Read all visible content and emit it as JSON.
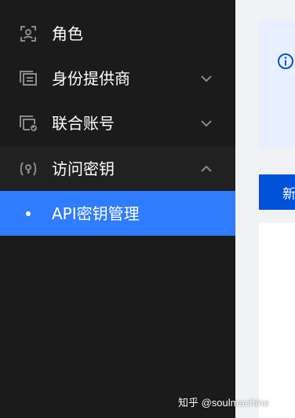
{
  "sidebar": {
    "items": [
      {
        "label": "角色",
        "icon": "role-icon",
        "expandable": false
      },
      {
        "label": "身份提供商",
        "icon": "identity-provider-icon",
        "expandable": true,
        "expanded": false
      },
      {
        "label": "联合账号",
        "icon": "federated-account-icon",
        "expandable": true,
        "expanded": false
      },
      {
        "label": "访问密钥",
        "icon": "access-key-icon",
        "expandable": true,
        "expanded": true
      }
    ],
    "subitems": [
      {
        "label": "API密钥管理",
        "selected": true
      }
    ]
  },
  "main": {
    "notice": {
      "icon": "info-icon"
    },
    "new_button_label": "新"
  },
  "watermark": "知乎 @soulmachine",
  "colors": {
    "sidebar_bg": "#1b1b1b",
    "selected_bg": "#2f7cff",
    "primary_button": "#0052d9",
    "notice_bg": "#e8efff",
    "page_bg": "#f0f2f5"
  }
}
